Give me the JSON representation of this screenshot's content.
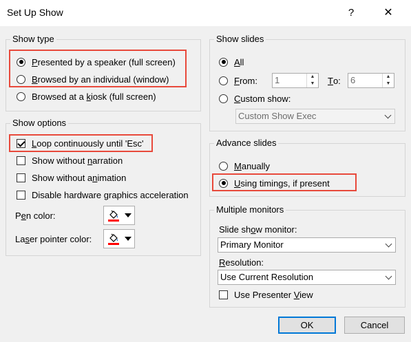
{
  "dialog": {
    "title": "Set Up Show",
    "help": "?",
    "close": "✕"
  },
  "show_type": {
    "legend": "Show type",
    "options": [
      {
        "pre": "",
        "key": "P",
        "post": "resented by a speaker (full screen)",
        "selected": true
      },
      {
        "pre": "",
        "key": "B",
        "post": "rowsed by an individual (window)",
        "selected": false
      },
      {
        "pre": "Browsed at a ",
        "key": "k",
        "post": "iosk (full screen)",
        "selected": false
      }
    ]
  },
  "show_options": {
    "legend": "Show options",
    "items": [
      {
        "pre": "",
        "key": "L",
        "post": "oop continuously until 'Esc'",
        "checked": true
      },
      {
        "pre": "Show without ",
        "key": "n",
        "post": "arration",
        "checked": false
      },
      {
        "pre": "Show without a",
        "key": "n",
        "post": "imation",
        "checked": false
      },
      {
        "pre": "Disable hardware ",
        "key": "g",
        "post": "raphics acceleration",
        "checked": false
      }
    ],
    "pen_color": {
      "pre": "P",
      "key": "e",
      "post": "n color:",
      "color": "#ff0000"
    },
    "laser_color": {
      "pre": "La",
      "key": "s",
      "post": "er pointer color:",
      "color": "#ff0000"
    }
  },
  "show_slides": {
    "legend": "Show slides",
    "all": {
      "pre": "",
      "key": "A",
      "post": "ll",
      "selected": true
    },
    "from": {
      "pre": "",
      "key": "F",
      "post": "rom:",
      "selected": false,
      "value": "1"
    },
    "to": {
      "pre": "",
      "key": "T",
      "post": "o:",
      "value": "6"
    },
    "custom": {
      "pre": "",
      "key": "C",
      "post": "ustom show:",
      "selected": false
    },
    "custom_value": "Custom Show Exec"
  },
  "advance_slides": {
    "legend": "Advance slides",
    "manually": {
      "pre": "",
      "key": "M",
      "post": "anually",
      "selected": false
    },
    "timings": {
      "pre": "",
      "key": "U",
      "post": "sing timings, if present",
      "selected": true
    }
  },
  "monitors": {
    "legend": "Multiple monitors",
    "monitor_label": {
      "pre": "Slide sh",
      "key": "o",
      "post": "w monitor:"
    },
    "monitor_value": "Primary Monitor",
    "resolution_label": {
      "pre": "",
      "key": "R",
      "post": "esolution:"
    },
    "resolution_value": "Use Current Resolution",
    "presenter": {
      "pre": "Use Presenter ",
      "key": "V",
      "post": "iew",
      "checked": false
    }
  },
  "buttons": {
    "ok": "OK",
    "cancel": "Cancel"
  },
  "colors": {
    "highlight": "#e8493b",
    "accent": "#0078d7"
  }
}
